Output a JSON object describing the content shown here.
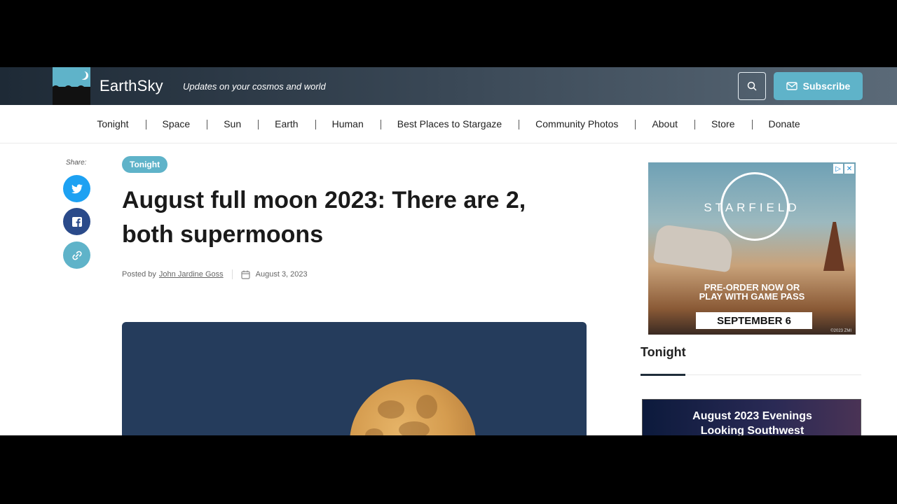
{
  "header": {
    "brand": "EarthSky",
    "tagline": "Updates on your cosmos and world",
    "subscribe_label": "Subscribe",
    "accent_color": "#5fb3c9"
  },
  "nav": {
    "items": [
      "Tonight",
      "Space",
      "Sun",
      "Earth",
      "Human",
      "Best Places to Stargaze",
      "Community Photos",
      "About",
      "Store",
      "Donate"
    ]
  },
  "share": {
    "label": "Share:"
  },
  "article": {
    "tag": "Tonight",
    "title": "August full moon 2023: There are 2, both supermoons",
    "posted_by_label": "Posted by",
    "author": "John Jardine Goss",
    "date": "August 3, 2023"
  },
  "ad": {
    "title": "STARFIELD",
    "cta_line1": "PRE-ORDER NOW OR",
    "cta_line2": "PLAY WITH GAME PASS",
    "date": "SEPTEMBER 6",
    "copyright": "©2023 ZMI"
  },
  "sidebar": {
    "section_title": "Tonight",
    "card_line1": "August 2023 Evenings",
    "card_line2": "Looking Southwest"
  }
}
